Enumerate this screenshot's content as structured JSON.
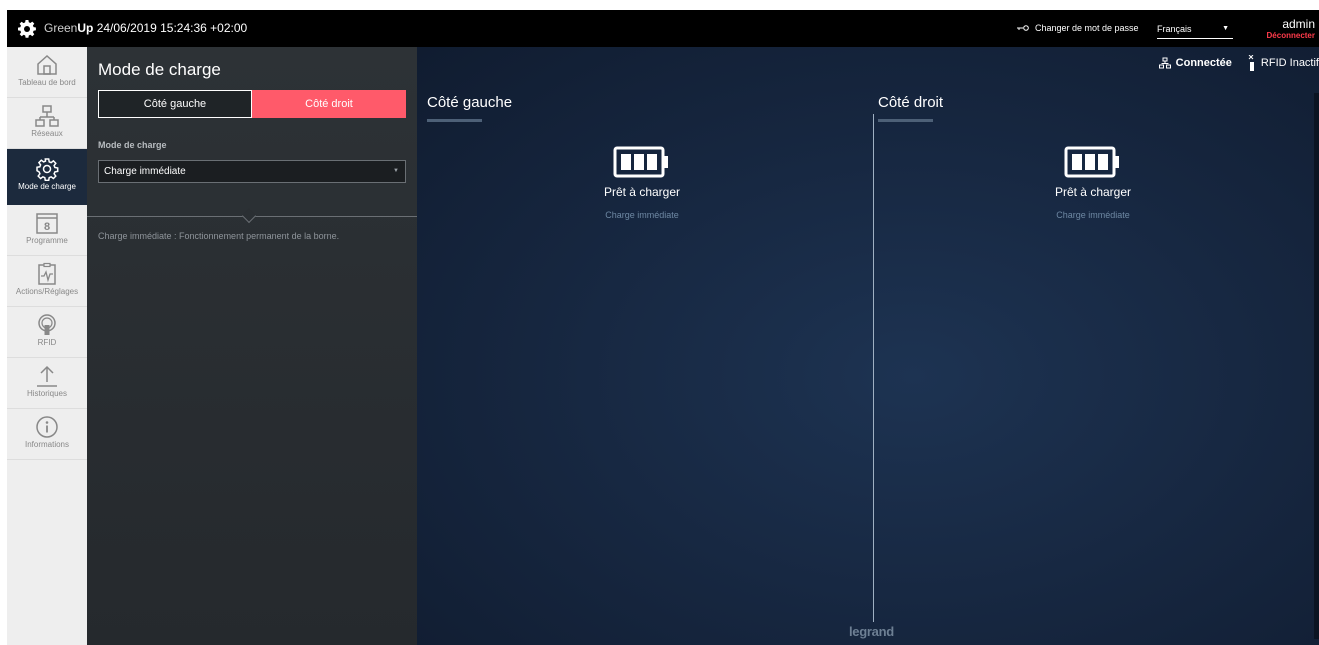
{
  "topbar": {
    "brand_light": "Green",
    "brand_bold": "Up",
    "datetime": "24/06/2019 15:24:36 +02:00",
    "change_password": "Changer de mot de passe",
    "language": "Français",
    "user": "admin",
    "logout": "Déconnecter"
  },
  "sidebar": {
    "items": [
      {
        "label": "Tableau de bord",
        "icon": "home-icon"
      },
      {
        "label": "Réseaux",
        "icon": "network-icon"
      },
      {
        "label": "Mode de charge",
        "icon": "gear-icon",
        "active": true
      },
      {
        "label": "Programme",
        "icon": "calendar-icon",
        "icon_text": "8"
      },
      {
        "label": "Actions/Réglages",
        "icon": "clipboard-icon"
      },
      {
        "label": "RFID",
        "icon": "rfid-icon"
      },
      {
        "label": "Historiques",
        "icon": "upload-icon"
      },
      {
        "label": "Informations",
        "icon": "info-icon"
      }
    ]
  },
  "panel": {
    "title": "Mode de charge",
    "tabs": [
      "Côté gauche",
      "Côté droit"
    ],
    "active_tab": "Côté droit",
    "field_label": "Mode de charge",
    "select_value": "Charge immédiate",
    "description": "Charge immédiate : Fonctionnement permanent de la borne."
  },
  "main": {
    "network_status": "Connectée",
    "rfid_status": "RFID Inactif",
    "left": {
      "title": "Côté gauche",
      "state": "Prêt à charger",
      "mode": "Charge immédiate"
    },
    "right": {
      "title": "Côté droit",
      "state": "Prêt à charger",
      "mode": "Charge immédiate"
    },
    "brand": "legrand"
  },
  "colors": {
    "accent": "#ff5a6a",
    "topbar": "#000000",
    "sidebar": "#eeeeee",
    "sidebar_active": "#1c2a3d",
    "panel": "#2a2f33",
    "main": "#16263f",
    "logout": "#ff3b4b"
  }
}
